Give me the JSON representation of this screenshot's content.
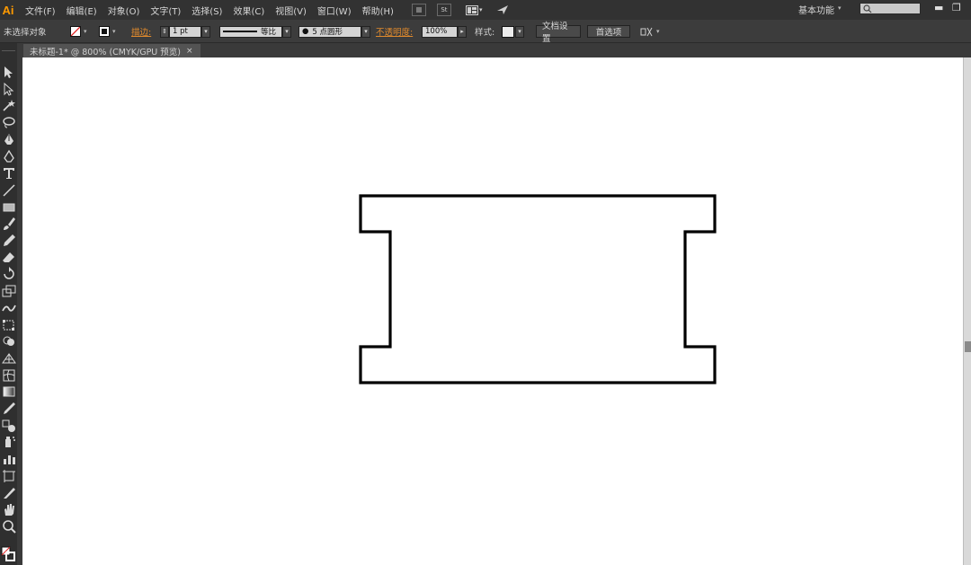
{
  "app": {
    "logo": "Ai",
    "accent": "#ff9a00",
    "workspace": "基本功能"
  },
  "menu": [
    "文件(F)",
    "编辑(E)",
    "对象(O)",
    "文字(T)",
    "选择(S)",
    "效果(C)",
    "视图(V)",
    "窗口(W)",
    "帮助(H)"
  ],
  "menu_icons": {
    "bridge": "bridge-icon",
    "stock": "St",
    "arrange": "arrange-documents-icon",
    "sync": "sync-icon"
  },
  "control": {
    "selection_status": "未选择对象",
    "stroke_label": "描边:",
    "stroke_weight": "1 pt",
    "profile_label": "等比",
    "brush_label": "5 点圆形",
    "opacity_label": "不透明度:",
    "opacity_value": "100%",
    "style_label": "样式:",
    "doc_setup_button": "文档设置",
    "preferences_button": "首选项"
  },
  "document": {
    "tab_title": "未标题-1* @ 800% (CMYK/GPU 预览)",
    "close": "×"
  },
  "tools": [
    "selection-icon",
    "direct-selection-icon",
    "magic-wand-icon",
    "lasso-icon",
    "pen-icon",
    "curvature-icon",
    "type-icon",
    "line-segment-icon",
    "rectangle-icon",
    "paintbrush-icon",
    "pencil-icon",
    "eraser-icon",
    "rotate-icon",
    "scale-icon",
    "warp-icon",
    "free-transform-icon",
    "shape-builder-icon",
    "perspective-grid-icon",
    "mesh-icon",
    "gradient-icon",
    "eyedropper-icon",
    "blend-icon",
    "symbol-sprayer-icon",
    "column-graph-icon",
    "artboard-icon",
    "slice-icon",
    "hand-icon",
    "zoom-icon"
  ],
  "shape": {
    "stroke": "#000000",
    "fill": "#ffffff",
    "kind": "closed-path"
  }
}
